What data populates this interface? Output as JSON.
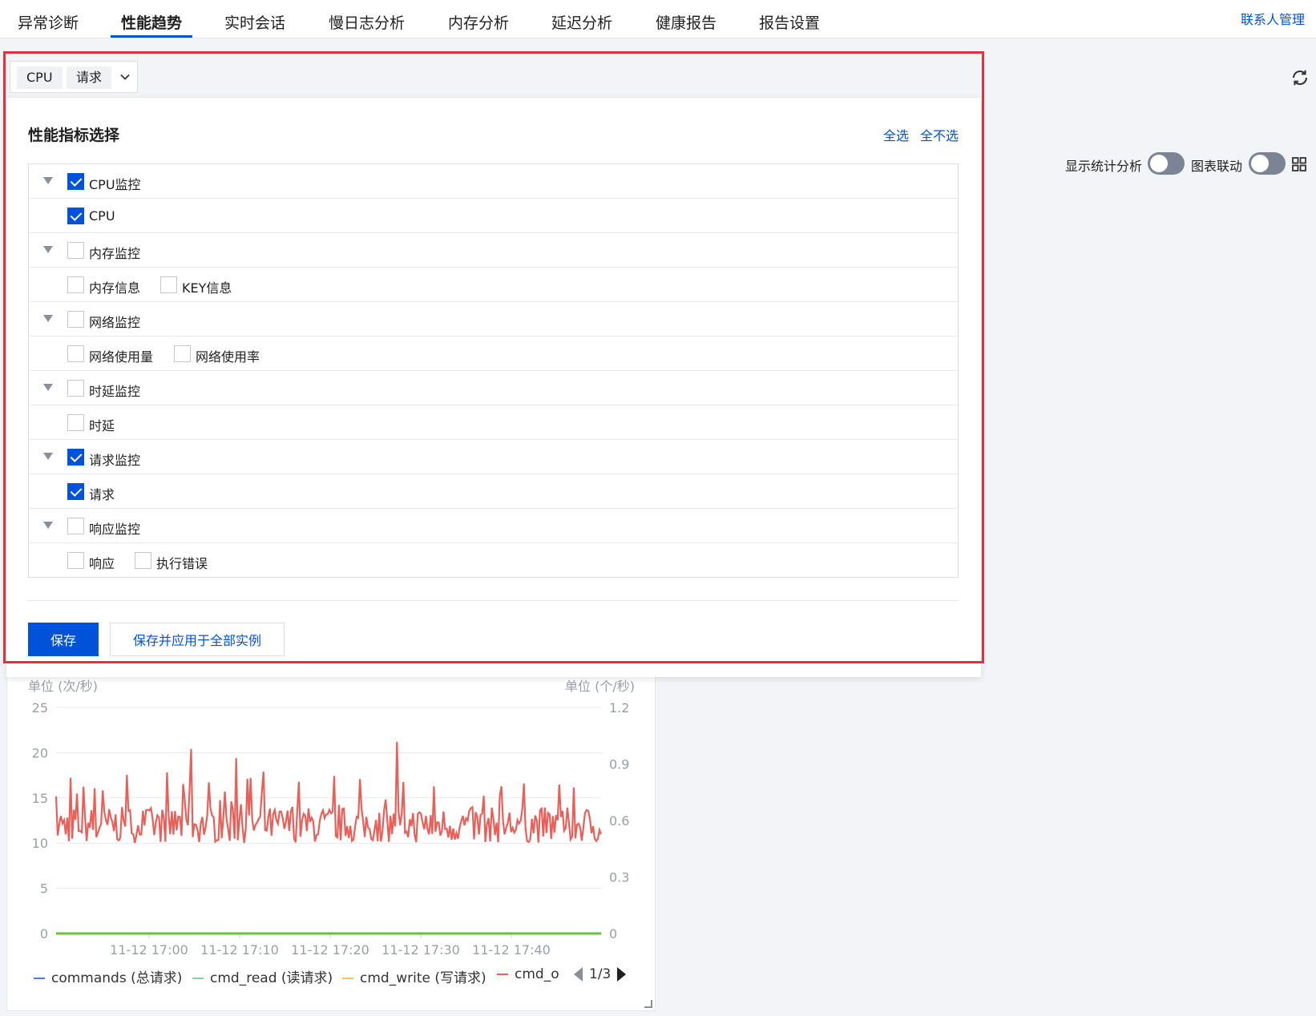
{
  "nav": {
    "tabs": [
      {
        "label": "异常诊断"
      },
      {
        "label": "性能趋势"
      },
      {
        "label": "实时会话"
      },
      {
        "label": "慢日志分析"
      },
      {
        "label": "内存分析"
      },
      {
        "label": "延迟分析"
      },
      {
        "label": "健康报告"
      },
      {
        "label": "报告设置"
      }
    ],
    "active_tab": "性能趋势",
    "contact_label": "联系人管理"
  },
  "controls": {
    "stats_label": "显示统计分析",
    "stats_on": false,
    "link_label": "图表联动",
    "link_on": false
  },
  "selector": {
    "tags": [
      "CPU",
      "请求"
    ]
  },
  "panel": {
    "title": "性能指标选择",
    "select_all": "全选",
    "select_none": "全不选",
    "groups": [
      {
        "label": "CPU监控",
        "checked": true,
        "items": [
          {
            "label": "CPU",
            "checked": true
          }
        ]
      },
      {
        "label": "内存监控",
        "checked": false,
        "items": [
          {
            "label": "内存信息",
            "checked": false
          },
          {
            "label": "KEY信息",
            "checked": false
          }
        ]
      },
      {
        "label": "网络监控",
        "checked": false,
        "items": [
          {
            "label": "网络使用量",
            "checked": false
          },
          {
            "label": "网络使用率",
            "checked": false
          }
        ]
      },
      {
        "label": "时延监控",
        "checked": false,
        "items": [
          {
            "label": "时延",
            "checked": false
          }
        ]
      },
      {
        "label": "请求监控",
        "checked": true,
        "items": [
          {
            "label": "请求",
            "checked": true
          }
        ]
      },
      {
        "label": "响应监控",
        "checked": false,
        "items": [
          {
            "label": "响应",
            "checked": false
          },
          {
            "label": "执行错误",
            "checked": false
          }
        ]
      }
    ],
    "save_label": "保存",
    "save_all_label": "保存并应用于全部实例"
  },
  "chart": {
    "legend_page": "1/3"
  },
  "chart_data": {
    "type": "line",
    "left_unit": "单位 (次/秒)",
    "right_unit": "单位 (个/秒)",
    "y_left_ticks": [
      "25",
      "20",
      "15",
      "10",
      "5",
      "0"
    ],
    "y_right_ticks": [
      "1.2",
      "0.9",
      "0.6",
      "0.3",
      "0"
    ],
    "ylim_left": [
      0,
      25
    ],
    "ylim_right": [
      0,
      1.2
    ],
    "x_ticks": [
      "11-12 17:00",
      "11-12 17:10",
      "11-12 17:20",
      "11-12 17:30",
      "11-12 17:40"
    ],
    "series": [
      {
        "name": "commands (总请求)",
        "color": "#4b7bec",
        "axis": "left"
      },
      {
        "name": "cmd_read (读请求)",
        "color": "#7ed6a5",
        "axis": "left"
      },
      {
        "name": "cmd_write (写请求)",
        "color": "#f5c84c",
        "axis": "left"
      },
      {
        "name": "cmd_o",
        "color": "#e8605a",
        "axis": "left",
        "baseline_min": 10,
        "baseline_max": 14,
        "peak_max": 21.2
      },
      {
        "name": "",
        "color": "#67c23a",
        "axis": "right",
        "constant": 0
      }
    ],
    "grid": true
  }
}
